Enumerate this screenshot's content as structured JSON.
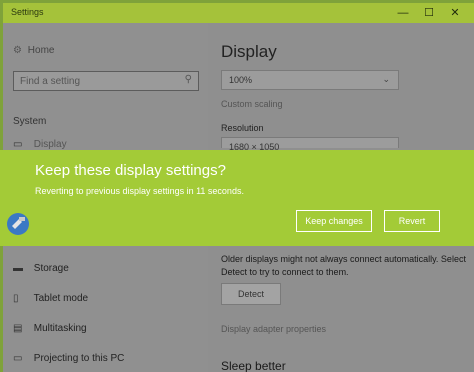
{
  "window": {
    "title": "Settings",
    "controls": {
      "minimize": "—",
      "maximize": "☐",
      "close": "✕"
    }
  },
  "sidebar": {
    "home_label": "Home",
    "home_icon": "gear-icon",
    "search_placeholder": "Find a setting",
    "search_icon": "search-icon",
    "section": "System",
    "items": [
      {
        "label": "Display",
        "icon": "display-icon"
      },
      {
        "label": "Storage",
        "icon": "storage-icon"
      },
      {
        "label": "Tablet mode",
        "icon": "tablet-icon"
      },
      {
        "label": "Multitasking",
        "icon": "multitasking-icon"
      },
      {
        "label": "Projecting to this PC",
        "icon": "projecting-icon"
      }
    ]
  },
  "main": {
    "title": "Display",
    "scale_value": "100%",
    "custom_scaling": "Custom scaling",
    "resolution_label": "Resolution",
    "resolution_value": "1680 × 1050",
    "detect_text": "Older displays might not always connect automatically. Select Detect to try to connect to them.",
    "detect_button": "Detect",
    "adapter_link": "Display adapter properties",
    "sleep_heading": "Sleep better"
  },
  "dialog": {
    "title": "Keep these display settings?",
    "message": "Reverting to previous display settings in 11 seconds.",
    "keep_label": "Keep changes",
    "revert_label": "Revert"
  },
  "colors": {
    "accent": "#a3cb37",
    "dimmed": "#8f8f8f"
  }
}
